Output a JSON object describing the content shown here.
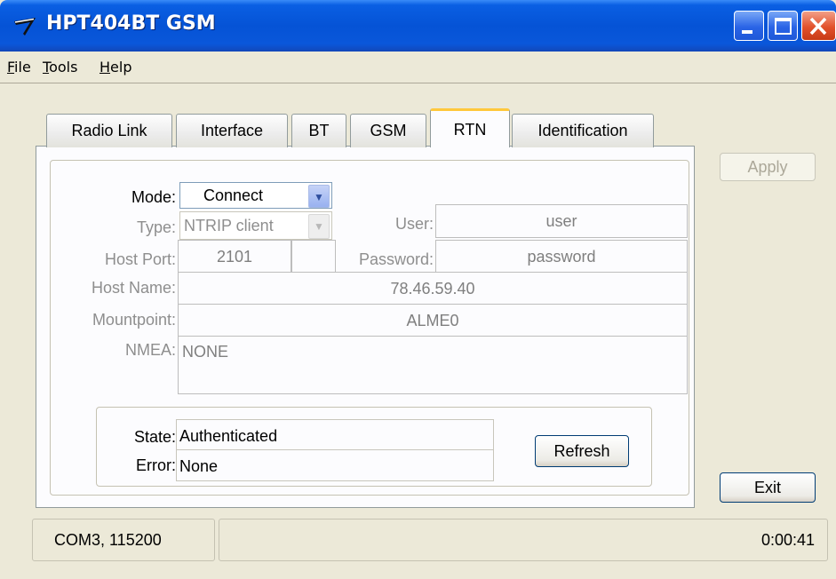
{
  "window": {
    "title": "HPT404BT GSM"
  },
  "menu": {
    "items": [
      {
        "key": "F",
        "rest": "ile"
      },
      {
        "key": "T",
        "rest": "ools"
      },
      {
        "key": "H",
        "rest": "elp"
      }
    ]
  },
  "tabs": [
    "Radio Link",
    "Interface",
    "BT",
    "GSM",
    "RTN",
    "Identification"
  ],
  "active_tab": "RTN",
  "rtn": {
    "mode_label": "Mode:",
    "mode_value": "Connect",
    "type_label": "Type:",
    "type_value": "NTRIP client",
    "user_label": "User:",
    "user_value": "user",
    "host_port_label": "Host Port:",
    "host_port_value": "2101",
    "password_label": "Password:",
    "password_value": "password",
    "host_name_label": "Host Name:",
    "host_name_value": "78.46.59.40",
    "mountpoint_label": "Mountpoint:",
    "mountpoint_value": "ALME0",
    "nmea_label": "NMEA:",
    "nmea_value": "NONE",
    "state_label": "State:",
    "state_value": "Authenticated",
    "error_label": "Error:",
    "error_value": "None",
    "refresh_label": "Refresh"
  },
  "buttons": {
    "apply": "Apply",
    "exit": "Exit"
  },
  "statusbar": {
    "port": "COM3, 115200",
    "time": "0:00:41"
  },
  "colors": {
    "titlebar": "#0553d6",
    "active_tab_accent": "#ffc83c",
    "close_button": "#e2512c"
  }
}
